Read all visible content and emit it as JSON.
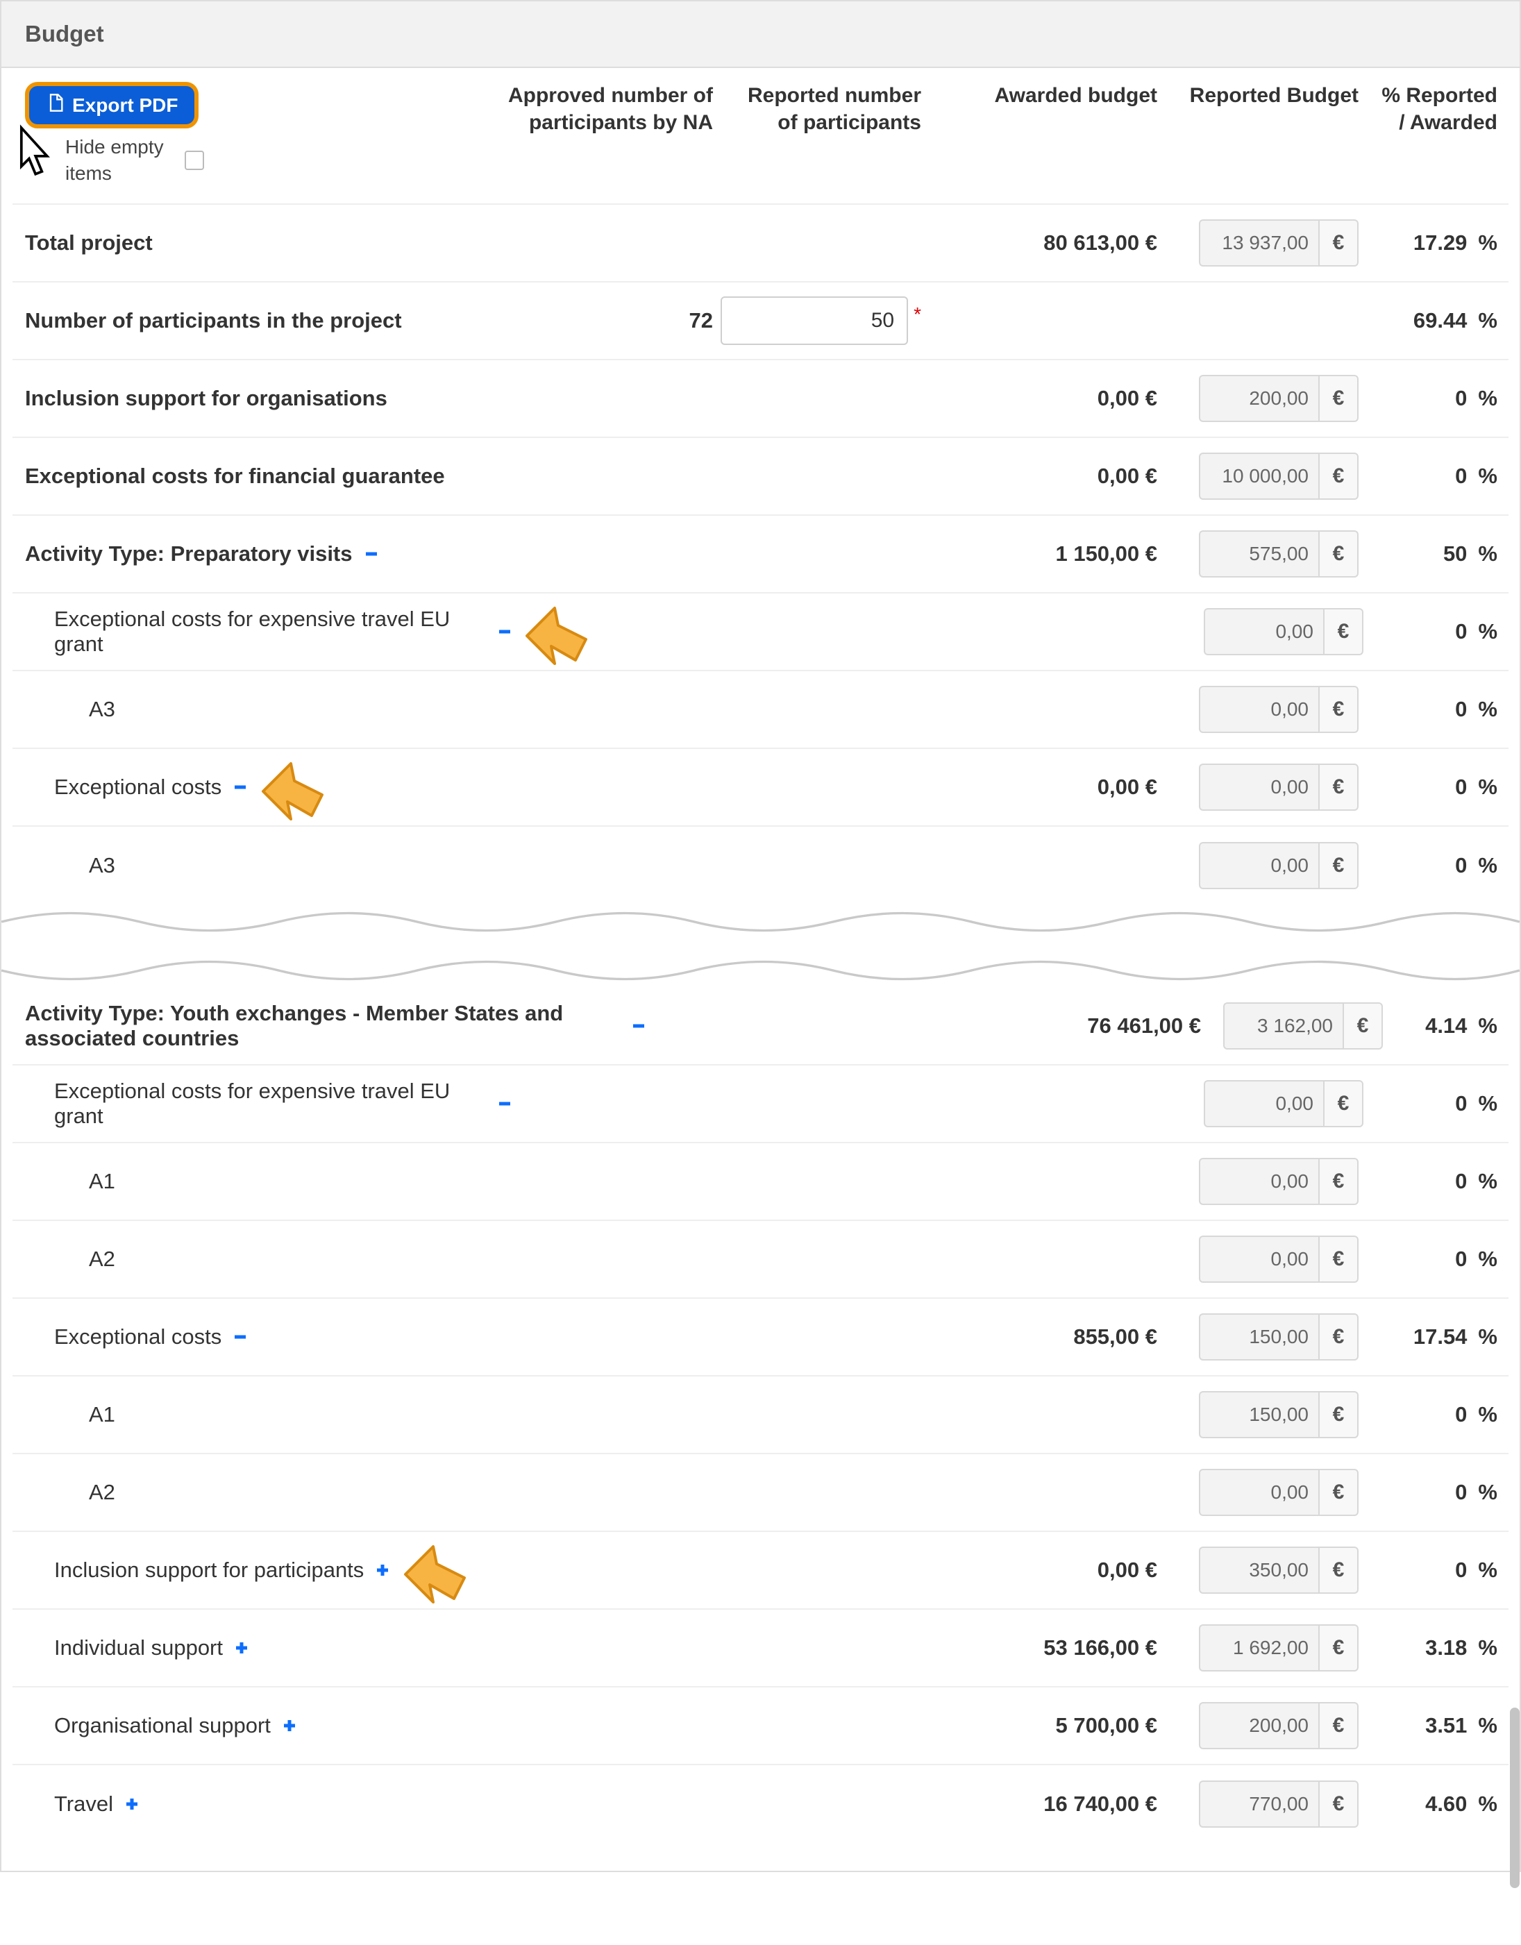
{
  "header": {
    "title": "Budget"
  },
  "toolbar": {
    "export_label": "Export PDF",
    "hide_empty_label": "Hide empty items"
  },
  "columns": {
    "approved": "Approved number of participants by NA",
    "reported_part": "Reported number of participants",
    "awarded": "Awarded budget",
    "reported_budget": "Reported Budget",
    "pct": "% Reported / Awarded"
  },
  "currency": "€",
  "pct_sym": "%",
  "rows1": [
    {
      "label": "Total project",
      "bold": true,
      "awarded": "80 613,00 €",
      "reported": "13 937,00",
      "pct": "17.29"
    },
    {
      "label": "Number of participants in the project",
      "bold": true,
      "approved": "72",
      "part_input": "50",
      "required": true,
      "pct": "69.44"
    },
    {
      "label": "Inclusion support for organisations",
      "bold": true,
      "awarded": "0,00 €",
      "reported": "200,00",
      "pct": "0"
    },
    {
      "label": "Exceptional costs for financial guarantee",
      "bold": true,
      "awarded": "0,00 €",
      "reported": "10 000,00",
      "pct": "0"
    },
    {
      "label": "Activity Type: Preparatory visits",
      "bold": true,
      "toggle": "minus",
      "awarded": "1 150,00 €",
      "reported": "575,00",
      "pct": "50"
    },
    {
      "label": "Exceptional costs for expensive travel EU grant",
      "indent": 1,
      "toggle": "minus",
      "reported": "0,00",
      "pct": "0",
      "arrow": true
    },
    {
      "label": "A3",
      "indent": 2,
      "reported": "0,00",
      "pct": "0"
    },
    {
      "label": "Exceptional costs",
      "indent": 1,
      "toggle": "minus",
      "awarded": "0,00 €",
      "reported": "0,00",
      "pct": "0",
      "arrow": true
    },
    {
      "label": "A3",
      "indent": 2,
      "reported": "0,00",
      "pct": "0"
    }
  ],
  "rows2": [
    {
      "label": "Activity Type: Youth exchanges - Member States and associated countries",
      "bold": true,
      "toggle": "minus",
      "awarded": "76 461,00 €",
      "reported": "3 162,00",
      "pct": "4.14"
    },
    {
      "label": "Exceptional costs for expensive travel EU grant",
      "indent": 1,
      "toggle": "minus",
      "reported": "0,00",
      "pct": "0"
    },
    {
      "label": "A1",
      "indent": 2,
      "reported": "0,00",
      "pct": "0"
    },
    {
      "label": "A2",
      "indent": 2,
      "reported": "0,00",
      "pct": "0"
    },
    {
      "label": "Exceptional costs",
      "indent": 1,
      "toggle": "minus",
      "awarded": "855,00 €",
      "reported": "150,00",
      "pct": "17.54"
    },
    {
      "label": "A1",
      "indent": 2,
      "reported": "150,00",
      "pct": "0"
    },
    {
      "label": "A2",
      "indent": 2,
      "reported": "0,00",
      "pct": "0"
    },
    {
      "label": "Inclusion support for participants",
      "indent": 1,
      "toggle": "plus",
      "awarded": "0,00 €",
      "reported": "350,00",
      "pct": "0",
      "arrow": true
    },
    {
      "label": "Individual support",
      "indent": 1,
      "toggle": "plus",
      "awarded": "53 166,00 €",
      "reported": "1 692,00",
      "pct": "3.18"
    },
    {
      "label": "Organisational support",
      "indent": 1,
      "toggle": "plus",
      "awarded": "5 700,00 €",
      "reported": "200,00",
      "pct": "3.51"
    },
    {
      "label": "Travel",
      "indent": 1,
      "toggle": "plus",
      "awarded": "16 740,00 €",
      "reported": "770,00",
      "pct": "4.60"
    }
  ]
}
